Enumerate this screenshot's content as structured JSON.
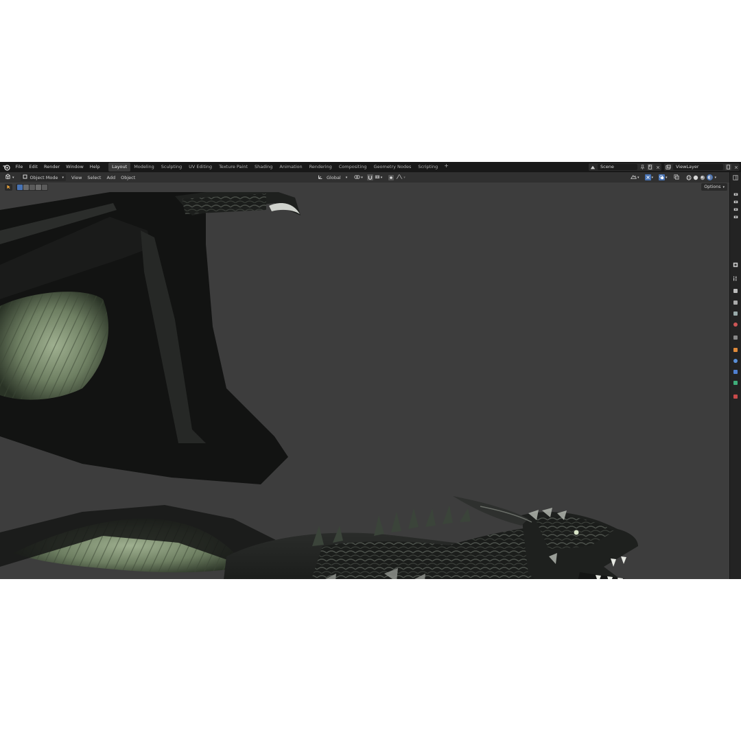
{
  "topbar": {
    "menu": [
      "File",
      "Edit",
      "Render",
      "Window",
      "Help"
    ],
    "workspaces": [
      "Layout",
      "Modeling",
      "Sculpting",
      "UV Editing",
      "Texture Paint",
      "Shading",
      "Animation",
      "Rendering",
      "Compositing",
      "Geometry Nodes",
      "Scripting"
    ],
    "active_workspace": "Layout",
    "add_tab_symbol": "+",
    "scene_name": "Scene",
    "view_layer_name": "ViewLayer"
  },
  "header": {
    "mode": "Object Mode",
    "menus": [
      "View",
      "Select",
      "Add",
      "Object"
    ],
    "transform_orientation": "Global"
  },
  "toolrow": {
    "options_label": "Options"
  },
  "icons": {
    "logo": "blender-logo-icon",
    "editor_type": "3d-viewport-icon",
    "pivot": "pivot-point-icon",
    "snap": "snap-magnet-icon",
    "proportional": "proportional-edit-icon",
    "visibility": "object-visibility-icon",
    "gizmo": "gizmo-icon",
    "overlay": "overlay-icon",
    "xray": "xray-icon",
    "shading_modes": [
      "wireframe-shading-icon",
      "solid-shading-icon",
      "material-preview-icon",
      "rendered-shading-icon"
    ]
  },
  "colors": {
    "viewport_bg": "#3d3d3d",
    "topbar_bg": "#181818",
    "header_bg": "#303030",
    "accent_blue": "#4772b3",
    "active_orange": "#e8a23a"
  }
}
